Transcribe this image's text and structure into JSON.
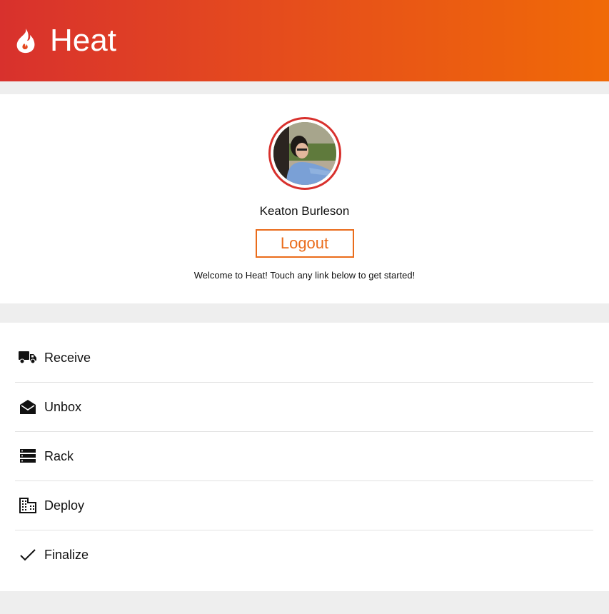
{
  "header": {
    "title": "Heat",
    "logo_icon": "flame-icon",
    "gradient_start": "#d8312d",
    "gradient_end": "#f06a07"
  },
  "profile": {
    "name": "Keaton Burleson",
    "logout_label": "Logout",
    "welcome_text": "Welcome to Heat! Touch any link below to get started!",
    "avatar_border_color": "#d8312d",
    "accent_color": "#ea6c1b"
  },
  "menu": {
    "items": [
      {
        "label": "Receive",
        "icon": "truck-icon"
      },
      {
        "label": "Unbox",
        "icon": "open-envelope-icon"
      },
      {
        "label": "Rack",
        "icon": "server-rack-icon"
      },
      {
        "label": "Deploy",
        "icon": "building-icon"
      },
      {
        "label": "Finalize",
        "icon": "checkmark-icon"
      }
    ]
  }
}
